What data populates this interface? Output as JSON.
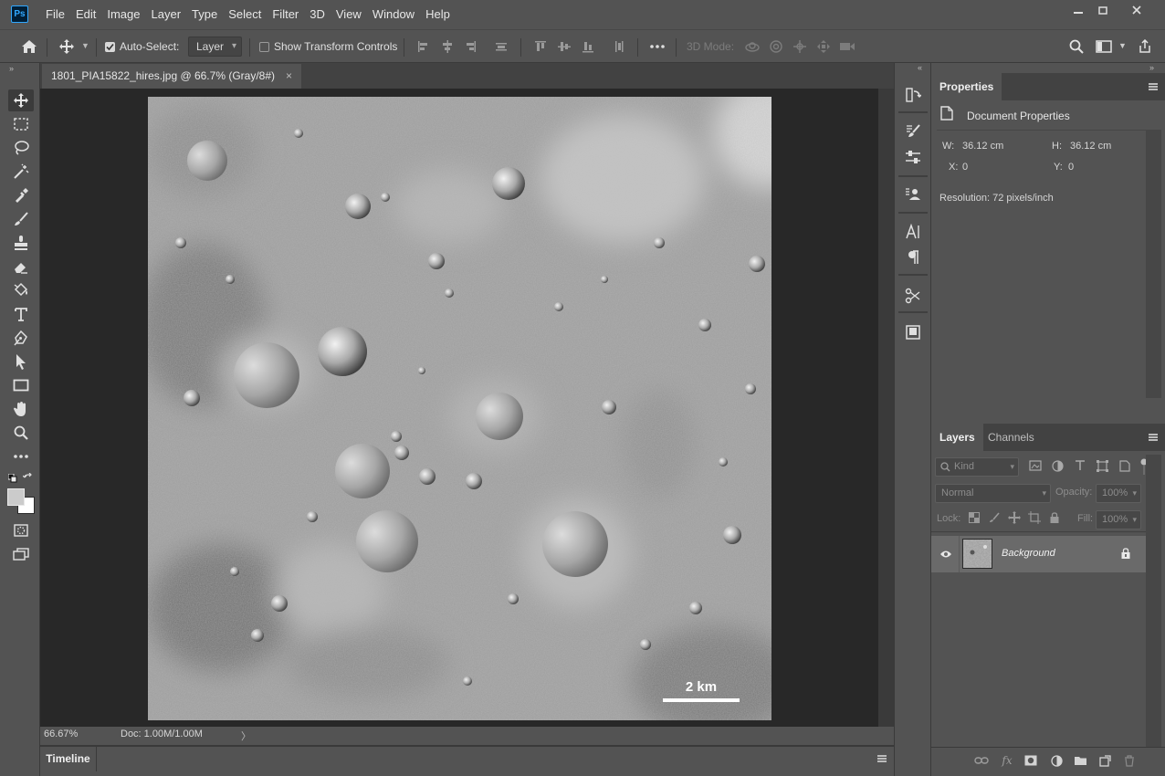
{
  "app": {
    "logo_text": "Ps"
  },
  "menu": [
    "File",
    "Edit",
    "Image",
    "Layer",
    "Type",
    "Select",
    "Filter",
    "3D",
    "View",
    "Window",
    "Help"
  ],
  "options_bar": {
    "auto_select_label": "Auto-Select:",
    "auto_select_checked": true,
    "auto_select_target": "Layer",
    "show_transform_label": "Show Transform Controls",
    "show_transform_checked": false,
    "mode_3d_label": "3D Mode:"
  },
  "document": {
    "tab_title": "1801_PIA15822_hires.jpg @ 66.7% (Gray/8#)",
    "tab_close": "×",
    "scale_label": "2 km"
  },
  "status_bar": {
    "zoom": "66.67%",
    "doc_size": "Doc: 1.00M/1.00M",
    "arrow": "〉"
  },
  "timeline": {
    "tab_label": "Timeline"
  },
  "properties": {
    "tab_label": "Properties",
    "section_title": "Document Properties",
    "w_label": "W:",
    "w_value": "36.12 cm",
    "h_label": "H:",
    "h_value": "36.12 cm",
    "x_label": "X:",
    "x_value": "0",
    "y_label": "Y:",
    "y_value": "0",
    "resolution": "Resolution: 72 pixels/inch"
  },
  "layers_panel": {
    "tabs": [
      "Layers",
      "Channels"
    ],
    "filter_kind": "Kind",
    "blend_mode": "Normal",
    "opacity_label": "Opacity:",
    "opacity_value": "100%",
    "lock_label": "Lock:",
    "fill_label": "Fill:",
    "fill_value": "100%",
    "layers": [
      {
        "name": "Background",
        "visible": true,
        "locked": true
      }
    ]
  },
  "colors": {
    "accent": "#31a8ff",
    "ui_bg": "#535353",
    "canvas_bg": "#282828",
    "selected_layer": "#6a6a6a"
  }
}
